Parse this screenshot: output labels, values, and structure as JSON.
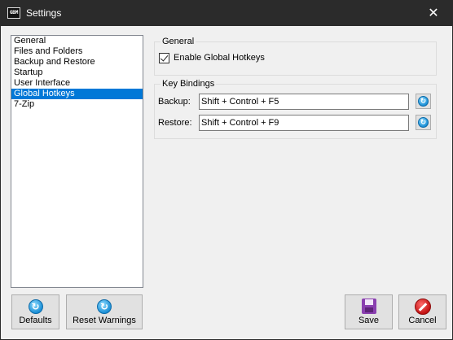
{
  "window": {
    "title": "Settings",
    "app_icon_text": "GBM",
    "close_glyph": "✕"
  },
  "nav": {
    "items": [
      {
        "label": "General"
      },
      {
        "label": "Files and Folders"
      },
      {
        "label": "Backup and Restore"
      },
      {
        "label": "Startup"
      },
      {
        "label": "User Interface"
      },
      {
        "label": "Global Hotkeys",
        "selected": true
      },
      {
        "label": "7-Zip"
      }
    ]
  },
  "general_group": {
    "title": "General",
    "enable_hotkeys_label": "Enable Global Hotkeys",
    "enable_hotkeys_checked": true
  },
  "keys_group": {
    "title": "Key Bindings",
    "backup_label": "Backup:",
    "backup_value": "Shift + Control + F5",
    "restore_label": "Restore:",
    "restore_value": "Shift + Control + F9"
  },
  "buttons": {
    "defaults": "Defaults",
    "reset_warnings": "Reset Warnings",
    "save": "Save",
    "cancel": "Cancel"
  },
  "icons": {
    "reset": "refresh-icon",
    "save": "floppy-disk-icon",
    "cancel": "cancel-icon"
  },
  "colors": {
    "titlebar": "#2b2b2b",
    "selection": "#0078d7",
    "save_icon": "#8a3fb0",
    "cancel_icon": "#c31212",
    "reset_icon": "#1b8fd6"
  }
}
